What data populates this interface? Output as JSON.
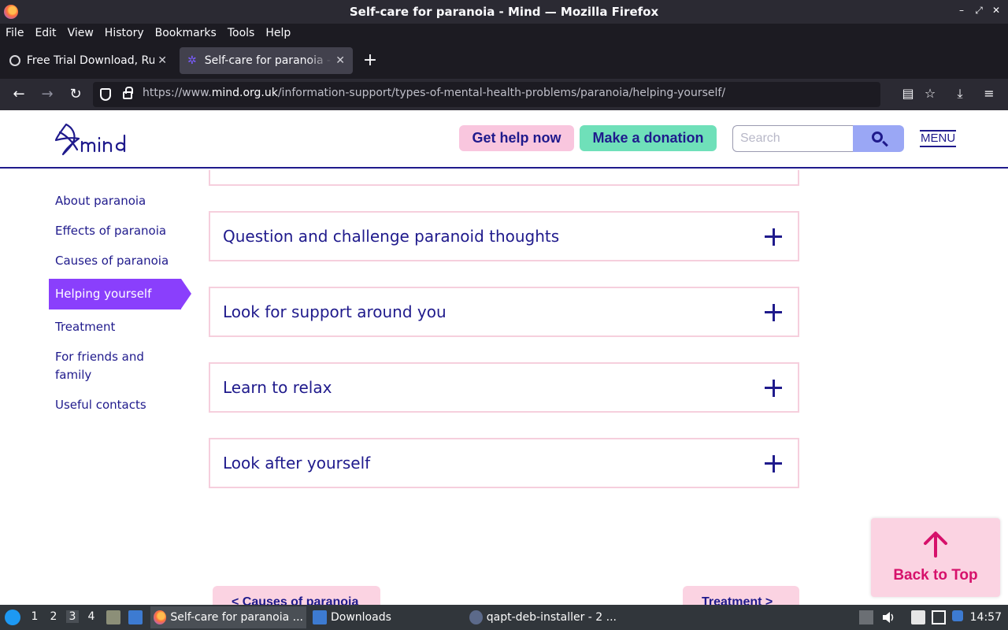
{
  "window": {
    "title": "Self-care for paranoia - Mind — Mozilla Firefox",
    "controls": [
      "–",
      "⤢",
      "✕"
    ]
  },
  "menubar": [
    "File",
    "Edit",
    "View",
    "History",
    "Bookmarks",
    "Tools",
    "Help"
  ],
  "tabs": [
    {
      "label": "Free Trial Download, Run",
      "close": "✕",
      "icon": "gear-favicon"
    },
    {
      "label": "Self-care for paranoia - Mind",
      "close": "✕",
      "icon": "mind-favicon",
      "active": true
    }
  ],
  "newtab": "+",
  "navbar": {
    "back": "←",
    "forward": "→",
    "reload": "↻",
    "url_prefix": "https://www.",
    "url_host": "mind.org.uk",
    "url_path": "/information-support/types-of-mental-health-problems/paranoia/helping-yourself/",
    "reader": "▤",
    "bookmark": "☆",
    "download": "⤓",
    "menu": "≡"
  },
  "header": {
    "get_help": "Get help now",
    "donate": "Make a donation",
    "search_placeholder": "Search",
    "menu": "MENU"
  },
  "sidenav": [
    {
      "label": "About paranoia"
    },
    {
      "label": "Effects of paranoia"
    },
    {
      "label": "Causes of paranoia"
    },
    {
      "label": "Helping yourself",
      "active": true
    },
    {
      "label": "Treatment"
    },
    {
      "label": "For friends and family"
    },
    {
      "label": "Useful contacts"
    }
  ],
  "accordion": [
    "Question and challenge paranoid thoughts",
    "Look for support around you",
    "Learn to relax",
    "Look after yourself"
  ],
  "back_to_top": "Back to Top",
  "prev_link": "< Causes of paranoia",
  "next_link": "Treatment >",
  "taskbar": {
    "workspaces": [
      "1",
      "2",
      "3",
      "4"
    ],
    "active_workspace": "3",
    "tasks": [
      {
        "label": "Self-care for paranoia ...",
        "active": true
      },
      {
        "label": "Downloads"
      },
      {
        "label": "qapt-deb-installer - 2 ..."
      }
    ],
    "clock": "14:57"
  },
  "colors": {
    "brand_navy": "#1f1a8c",
    "brand_pink": "#fbd3e2",
    "brand_mint": "#6fe0b9",
    "brand_purple": "#8a3ffc",
    "accent_red": "#d6116b"
  }
}
